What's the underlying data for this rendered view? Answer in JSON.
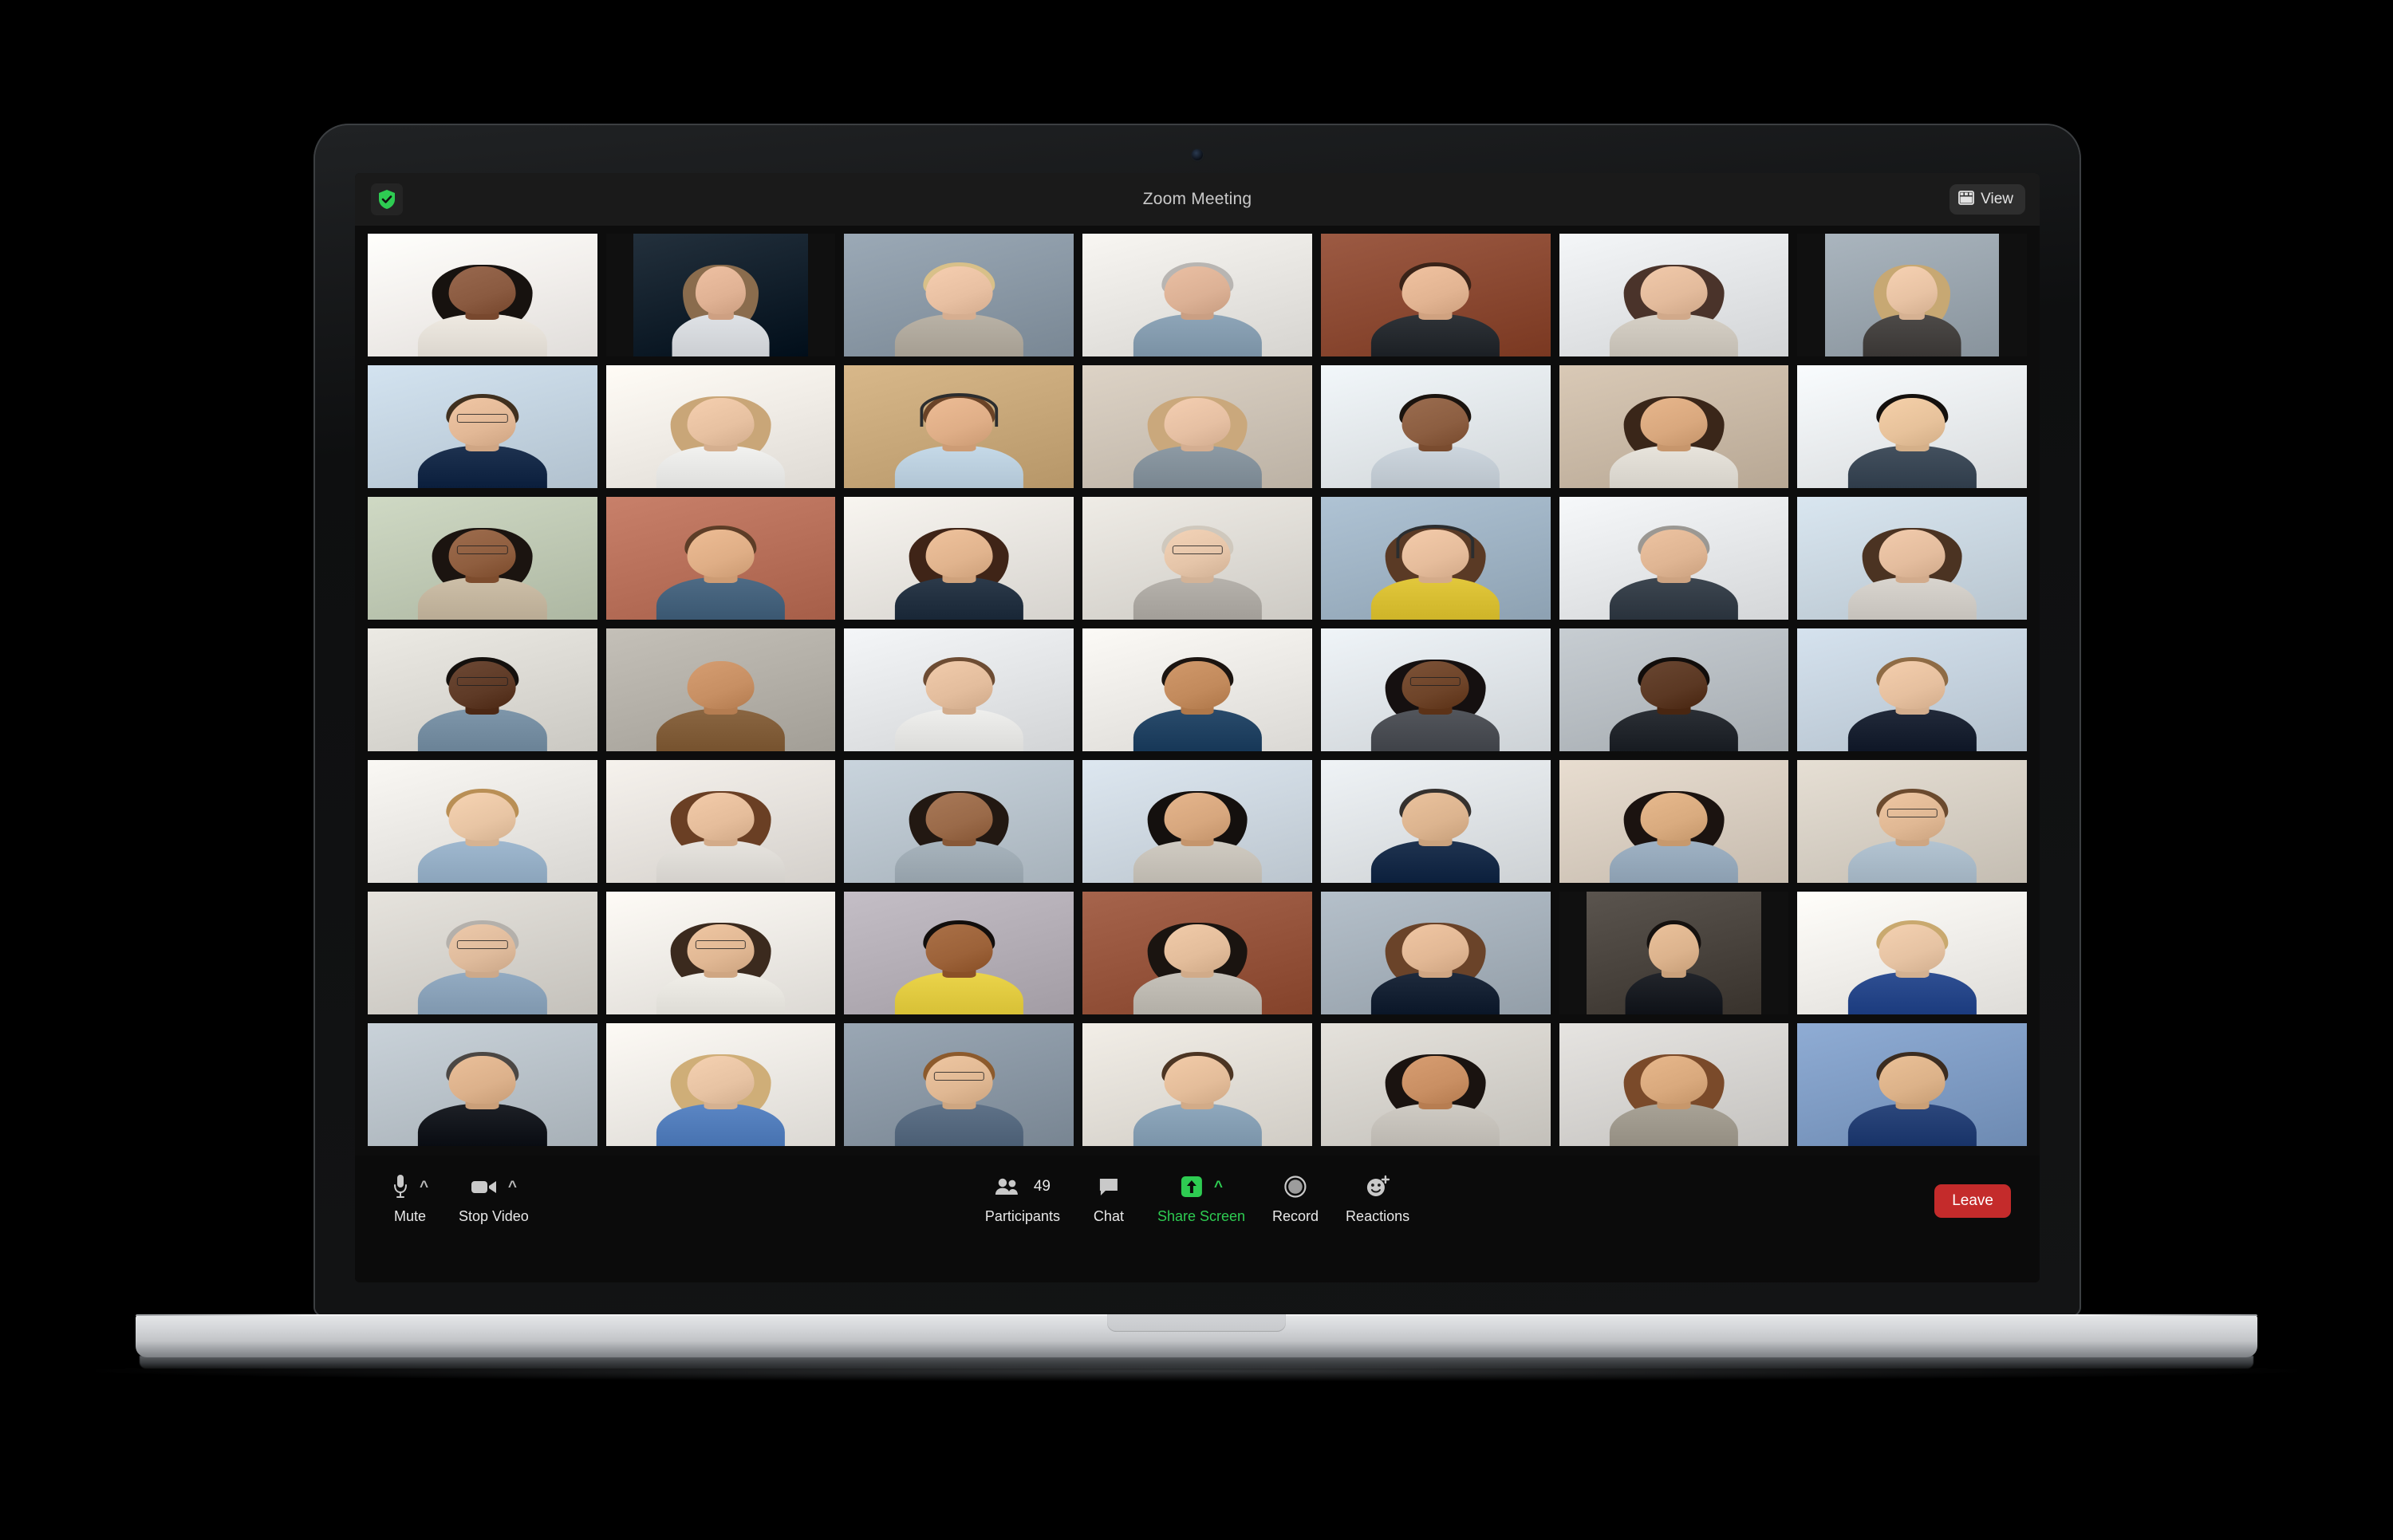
{
  "window": {
    "title": "Zoom Meeting",
    "encryption_icon": "shield-check-icon",
    "view_button": {
      "label": "View",
      "icon": "grid-layout-icon"
    }
  },
  "colors": {
    "active_speaker_border": "#cfe053",
    "share_screen_green": "#2ecc52",
    "leave_red": "#c42b2b",
    "app_background": "#0d0d0d",
    "titlebar_background": "#1a1a1a",
    "encryption_green": "#2ecc52"
  },
  "grid": {
    "columns": 7,
    "rows": 7,
    "tile_count": 49,
    "active_speaker_index": 9,
    "tiles": [
      {
        "id": 0,
        "bg": "#f2efec",
        "skin": "#8a5a40",
        "hair": "#17120f",
        "hair_style": "long",
        "top": "#efeae2",
        "room": "home-white-wall",
        "accessory": "none"
      },
      {
        "id": 1,
        "bg": "#13202c",
        "skin": "#e0b294",
        "hair": "#8a6c4d",
        "hair_style": "long",
        "top": "#dfe2e6",
        "room": "dark-navy-wall",
        "accessory": "none"
      },
      {
        "id": 2,
        "bg": "#8b99a6",
        "skin": "#e8c0a2",
        "hair": "#d8c089",
        "hair_style": "short",
        "top": "#b9b2a6",
        "room": "grey-blue-wall",
        "accessory": "none"
      },
      {
        "id": 3,
        "bg": "#e8e6e2",
        "skin": "#dcb195",
        "hair": "#b8b5b2",
        "hair_style": "short",
        "top": "#8ea5b8",
        "room": "office-open-plan",
        "accessory": "none"
      },
      {
        "id": 4,
        "bg": "#8c4a33",
        "skin": "#e2b492",
        "hair": "#3a2318",
        "hair_style": "short",
        "top": "#2f3338",
        "room": "brick-loft",
        "accessory": "none"
      },
      {
        "id": 5,
        "bg": "#e4e6e8",
        "skin": "#e3bb9c",
        "hair": "#4a332a",
        "hair_style": "long",
        "top": "#d6d0c6",
        "room": "bright-window",
        "accessory": "none"
      },
      {
        "id": 6,
        "bg": "#9aa5ae",
        "skin": "#e8c3a4",
        "hair": "#c7a873",
        "hair_style": "long",
        "top": "#4d4a48",
        "room": "grey-studio",
        "accessory": "none"
      },
      {
        "id": 7,
        "bg": "#c3d3e0",
        "skin": "#e2b896",
        "hair": "#40301f",
        "hair_style": "short",
        "top": "#1e3250",
        "room": "city-window",
        "accessory": "glasses"
      },
      {
        "id": 8,
        "bg": "#f0ece6",
        "skin": "#e7c1a1",
        "hair": "#c9a678",
        "hair_style": "long",
        "top": "#f2f2f0",
        "room": "home-living-room",
        "accessory": "none"
      },
      {
        "id": 9,
        "bg": "#c8a87a",
        "skin": "#dfae87",
        "hair": "#6a4327",
        "hair_style": "short",
        "top": "#c5d9e8",
        "room": "office-corridor",
        "accessory": "headset"
      },
      {
        "id": 10,
        "bg": "#cdc3b6",
        "skin": "#e6c0a3",
        "hair": "#caa87c",
        "hair_style": "long",
        "top": "#8d9aa4",
        "room": "kitchen-shelves",
        "accessory": "none"
      },
      {
        "id": 11,
        "bg": "#e2e7ea",
        "skin": "#8c5e41",
        "hair": "#1a130e",
        "hair_style": "short",
        "top": "#cdd6de",
        "room": "white-office",
        "accessory": "none"
      },
      {
        "id": 12,
        "bg": "#c9b9a6",
        "skin": "#d9a87e",
        "hair": "#3a2619",
        "hair_style": "long",
        "top": "#e8e4dc",
        "room": "bookshelf-brick",
        "accessory": "none"
      },
      {
        "id": 13,
        "bg": "#e9ecee",
        "skin": "#e7c29b",
        "hair": "#14100d",
        "hair_style": "short",
        "top": "#43505e",
        "room": "plain-white",
        "accessory": "none"
      },
      {
        "id": 14,
        "bg": "#bfc9b4",
        "skin": "#8f5e3f",
        "hair": "#1b1410",
        "hair_style": "long",
        "top": "#cdbfa8",
        "room": "plants-home",
        "accessory": "glasses"
      },
      {
        "id": 15,
        "bg": "#b8705a",
        "skin": "#dfae86",
        "hair": "#5d3d27",
        "hair_style": "short",
        "top": "#4e6b85",
        "room": "brick-wall-warm",
        "accessory": "none"
      },
      {
        "id": 16,
        "bg": "#e8e5e0",
        "skin": "#e1b48e",
        "hair": "#3f2417",
        "hair_style": "long",
        "top": "#2c3a4a",
        "room": "soft-white",
        "accessory": "none"
      },
      {
        "id": 17,
        "bg": "#dfdcd6",
        "skin": "#e5c5a9",
        "hair": "#cfc8bd",
        "hair_style": "short",
        "top": "#b6b2ac",
        "room": "home-lamp",
        "accessory": "glasses"
      },
      {
        "id": 18,
        "bg": "#9fb3c4",
        "skin": "#e6bd9c",
        "hair": "#5a3a25",
        "hair_style": "long",
        "top": "#e2c83c",
        "room": "office-city",
        "accessory": "headset"
      },
      {
        "id": 19,
        "bg": "#e6e8ea",
        "skin": "#dfb593",
        "hair": "#9b9893",
        "hair_style": "short",
        "top": "#3d4650",
        "room": "bright-office",
        "accessory": "none"
      },
      {
        "id": 20,
        "bg": "#c9d6e0",
        "skin": "#e4bd9e",
        "hair": "#4b3322",
        "hair_style": "long",
        "top": "#d9d5cf",
        "room": "window-city",
        "accessory": "none"
      },
      {
        "id": 21,
        "bg": "#dcdad4",
        "skin": "#5e3a26",
        "hair": "#14100d",
        "hair_style": "short",
        "top": "#7e96aa",
        "room": "shelf-plant",
        "accessory": "glasses"
      },
      {
        "id": 22,
        "bg": "#b4b0a8",
        "skin": "#c78f63",
        "hair": "#1a1411",
        "hair_style": "bald",
        "top": "#8a6642",
        "room": "grey-brick",
        "accessory": "none"
      },
      {
        "id": 23,
        "bg": "#e4e6e8",
        "skin": "#e3bd9d",
        "hair": "#6d4c33",
        "hair_style": "short",
        "top": "#efefed",
        "room": "sofa-grey",
        "accessory": "none"
      },
      {
        "id": 24,
        "bg": "#eceae6",
        "skin": "#c28a5c",
        "hair": "#1b1410",
        "hair_style": "short",
        "top": "#2a4b6b",
        "room": "kitchen-bright",
        "accessory": "none"
      },
      {
        "id": 25,
        "bg": "#dfe4e8",
        "skin": "#6e4429",
        "hair": "#151010",
        "hair_style": "long",
        "top": "#53565c",
        "room": "desk-window",
        "accessory": "glasses"
      },
      {
        "id": 26,
        "bg": "#b7bdc2",
        "skin": "#5b3823",
        "hair": "#110d0b",
        "hair_style": "short",
        "top": "#2b2f35",
        "room": "open-office",
        "accessory": "none"
      },
      {
        "id": 27,
        "bg": "#c5d2de",
        "skin": "#e6c09f",
        "hair": "#8e6b45",
        "hair_style": "short",
        "top": "#222a3a",
        "room": "office-blue",
        "accessory": "none"
      },
      {
        "id": 28,
        "bg": "#eae8e4",
        "skin": "#e8c5a4",
        "hair": "#b98f55",
        "hair_style": "short",
        "top": "#9fb8cf",
        "room": "plain-bright",
        "accessory": "none"
      },
      {
        "id": 29,
        "bg": "#e6e2dd",
        "skin": "#e5bd9b",
        "hair": "#6a3f24",
        "hair_style": "long",
        "top": "#e7e4df",
        "room": "home-soft",
        "accessory": "none"
      },
      {
        "id": 30,
        "bg": "#b9c4cd",
        "skin": "#9a6a49",
        "hair": "#221812",
        "hair_style": "long",
        "top": "#a8b4bd",
        "room": "window-sofa",
        "accessory": "none"
      },
      {
        "id": 31,
        "bg": "#cdd7e0",
        "skin": "#d7a77e",
        "hair": "#14100e",
        "hair_style": "long",
        "top": "#d0cbc2",
        "room": "stairs-glass",
        "accessory": "none"
      },
      {
        "id": 32,
        "bg": "#dfe3e6",
        "skin": "#dcb48f",
        "hair": "#35312e",
        "hair_style": "short",
        "top": "#1f3350",
        "room": "office-light",
        "accessory": "none"
      },
      {
        "id": 33,
        "bg": "#d8cdc0",
        "skin": "#d9ab7f",
        "hair": "#1b1310",
        "hair_style": "long",
        "top": "#9fb2c4",
        "room": "bookshelf-white",
        "accessory": "none"
      },
      {
        "id": 34,
        "bg": "#d6cfc4",
        "skin": "#e0b894",
        "hair": "#6b4a2e",
        "hair_style": "short",
        "top": "#b3c4d2",
        "room": "library-shelf",
        "accessory": "glasses"
      },
      {
        "id": 35,
        "bg": "#d6d3cd",
        "skin": "#dfbb9c",
        "hair": "#b4b0ab",
        "hair_style": "short",
        "top": "#93abc2",
        "room": "home-cozy",
        "accessory": "glasses"
      },
      {
        "id": 36,
        "bg": "#eeebe6",
        "skin": "#e1b894",
        "hair": "#3b2a1e",
        "hair_style": "long",
        "top": "#f1efe9",
        "room": "white-room-plant",
        "accessory": "glasses"
      },
      {
        "id": 37,
        "bg": "#b4aeb6",
        "skin": "#9c6239",
        "hair": "#120e0c",
        "hair_style": "short",
        "top": "#ebd44a",
        "room": "grey-studio-wall",
        "accessory": "none"
      },
      {
        "id": 38,
        "bg": "#96543c",
        "skin": "#e3bd9b",
        "hair": "#1a1410",
        "hair_style": "long",
        "top": "#c6c2ba",
        "room": "brick-warm",
        "accessory": "none"
      },
      {
        "id": 39,
        "bg": "#a5b0ba",
        "skin": "#e2b895",
        "hair": "#6a4329",
        "hair_style": "long",
        "top": "#1e2a3c",
        "room": "grey-office",
        "accessory": "none"
      },
      {
        "id": 40,
        "bg": "#4a443e",
        "skin": "#dcb38d",
        "hair": "#15110f",
        "hair_style": "short",
        "top": "#22252b",
        "room": "dark-wood-panel",
        "accessory": "none"
      },
      {
        "id": 41,
        "bg": "#f0eeea",
        "skin": "#e6c3a3",
        "hair": "#c9a96f",
        "hair_style": "short",
        "top": "#2f4f92",
        "room": "bright-plain",
        "accessory": "none"
      },
      {
        "id": 42,
        "bg": "#b9c2c9",
        "skin": "#dcb18b",
        "hair": "#4b4744",
        "hair_style": "short",
        "top": "#1d2026",
        "room": "grey-gradient",
        "accessory": "none"
      },
      {
        "id": 43,
        "bg": "#edeae5",
        "skin": "#e7c3a3",
        "hair": "#cfae78",
        "hair_style": "long",
        "top": "#5b86c4",
        "room": "white-curtain",
        "accessory": "none"
      },
      {
        "id": 44,
        "bg": "#8a97a4",
        "skin": "#e0b893",
        "hair": "#8c5a2c",
        "hair_style": "short",
        "top": "#5f7288",
        "room": "office-dim",
        "accessory": "glasses"
      },
      {
        "id": 45,
        "bg": "#e2ded7",
        "skin": "#e4bd9a",
        "hair": "#4c3523",
        "hair_style": "short",
        "top": "#8fa8bd",
        "room": "home-shelves",
        "accessory": "none"
      },
      {
        "id": 46,
        "bg": "#d5d2cc",
        "skin": "#c98f63",
        "hair": "#1a1310",
        "hair_style": "long",
        "top": "#cfcbc4",
        "room": "office-blur",
        "accessory": "none"
      },
      {
        "id": 47,
        "bg": "#d6d4d1",
        "skin": "#d9a97d",
        "hair": "#7a4a2a",
        "hair_style": "hijab",
        "top": "#a8a296",
        "room": "plain-grey",
        "accessory": "none"
      },
      {
        "id": 48,
        "bg": "#7f9cc4",
        "skin": "#dcb289",
        "hair": "#3b2c20",
        "hair_style": "short",
        "top": "#2c477c",
        "room": "blue-blinds",
        "accessory": "none"
      }
    ]
  },
  "toolbar": {
    "left": [
      {
        "id": "mute",
        "label": "Mute",
        "icon": "microphone-icon",
        "has_chevron": true
      },
      {
        "id": "stop-video",
        "label": "Stop Video",
        "icon": "camera-icon",
        "has_chevron": true
      }
    ],
    "center": [
      {
        "id": "participants",
        "label": "Participants",
        "icon": "people-icon",
        "count": "49",
        "has_chevron": false,
        "active": false
      },
      {
        "id": "chat",
        "label": "Chat",
        "icon": "chat-bubble-icon",
        "count": null,
        "has_chevron": false,
        "active": false
      },
      {
        "id": "share-screen",
        "label": "Share Screen",
        "icon": "share-arrow-icon",
        "count": null,
        "has_chevron": true,
        "active": true
      },
      {
        "id": "record",
        "label": "Record",
        "icon": "record-circle-icon",
        "count": null,
        "has_chevron": false,
        "active": false
      },
      {
        "id": "reactions",
        "label": "Reactions",
        "icon": "smiley-plus-icon",
        "count": null,
        "has_chevron": false,
        "active": false
      }
    ],
    "right": {
      "leave_label": "Leave"
    }
  }
}
